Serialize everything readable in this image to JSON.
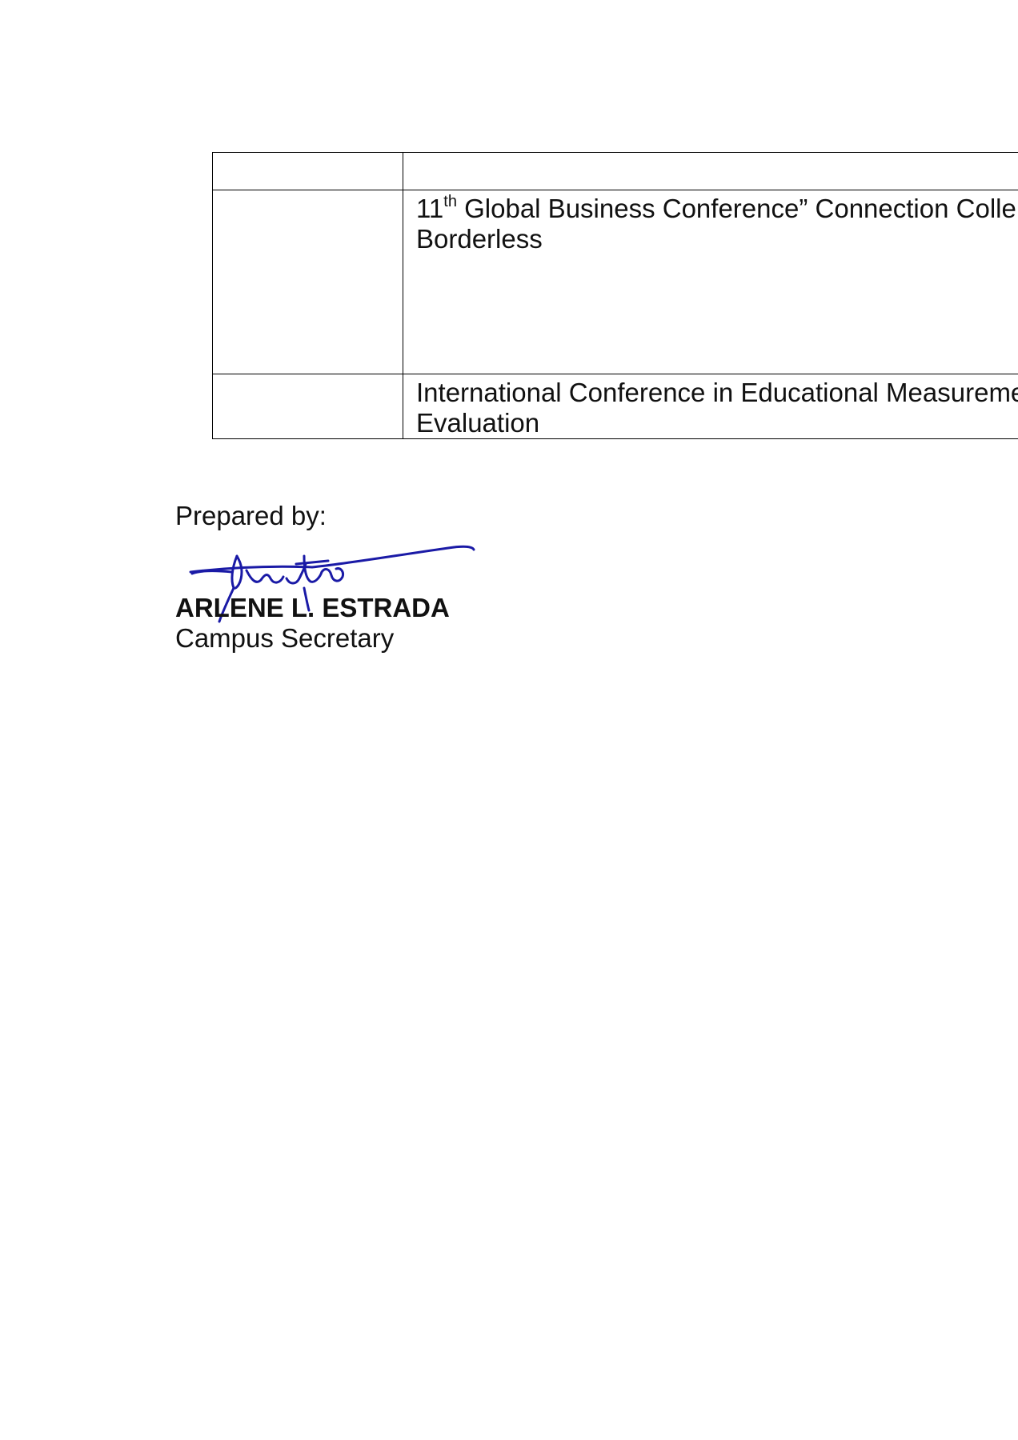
{
  "table": {
    "rows": [
      {
        "col1": "",
        "col2_line1": "",
        "col2_line2": ""
      },
      {
        "col1": "",
        "col2_prefix": "11",
        "col2_sup": "th",
        "col2_line1": " Global Business Conference”  Connection Colle",
        "col2_line2": "Borderless"
      },
      {
        "col1": "",
        "col2_line1": "International Conference in Educational Measureme",
        "col2_line2": "Evaluation"
      }
    ]
  },
  "signoff": {
    "prepared_label": "Prepared by:",
    "name": "ARLENE L. ESTRADA",
    "title": "Campus Secretary"
  },
  "colors": {
    "signature_ink": "#1a1aa6",
    "text": "#111111",
    "border": "#000000"
  }
}
